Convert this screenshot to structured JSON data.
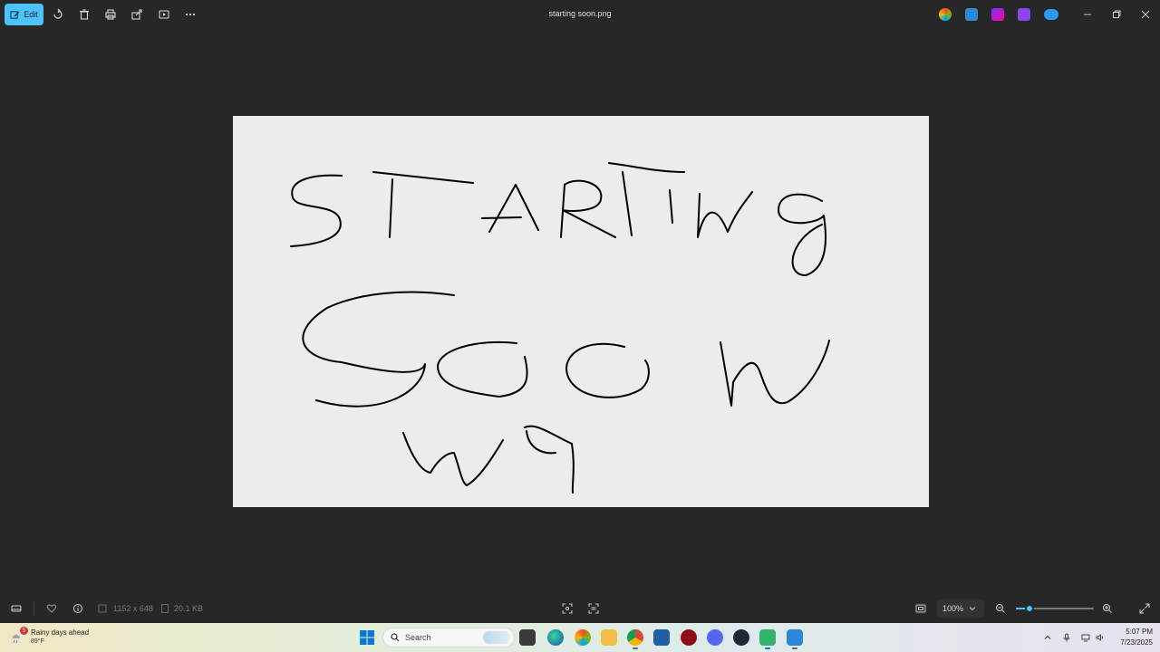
{
  "toolbar": {
    "edit_label": "Edit",
    "icons": [
      "rotate-icon",
      "delete-icon",
      "print-icon",
      "share-icon",
      "slideshow-icon",
      "more-icon"
    ]
  },
  "window": {
    "title": "starting soon.png"
  },
  "image": {
    "handwritten_lines": [
      "STARTING",
      "SOON",
      "W9"
    ]
  },
  "statusbar": {
    "dimensions": "1152 x 648",
    "file_size": "20.1 KB",
    "zoom": "100%"
  },
  "taskbar": {
    "weather_title": "Rainy days ahead",
    "weather_temp": "89°F",
    "weather_badge": "5",
    "search_placeholder": "Search",
    "time": "5:07 PM",
    "date": "7/23/2025"
  },
  "colors": {
    "accent": "#4cc2ff",
    "background": "#272727",
    "canvas": "#ececec"
  }
}
